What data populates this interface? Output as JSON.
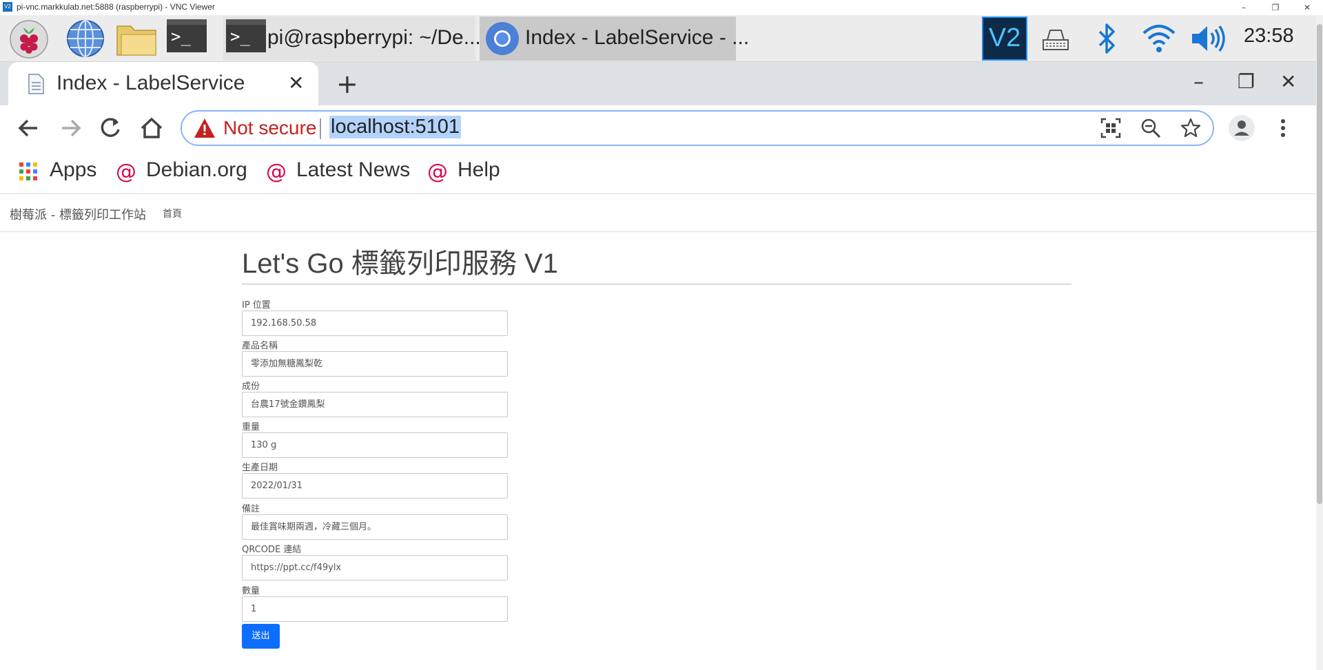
{
  "vnc_window": {
    "logo_text": "V2",
    "title": "pi-vnc.markkulab.net:5888 (raspberrypi) - VNC Viewer",
    "minimize": "–",
    "restore": "❐",
    "close": "✕"
  },
  "taskbar": {
    "terminal_prompt": ">_",
    "terminal_task_label": "pi@raspberrypi: ~/De...",
    "browser_task_label": "Index - LabelService - ...",
    "vnc_tray_text": "V2",
    "time": "23:58"
  },
  "browser": {
    "tab_title": "Index - LabelService",
    "tab_close": "✕",
    "new_tab": "+",
    "window_minimize": "–",
    "window_restore": "❐",
    "window_close": "✕",
    "security_label": "Not secure",
    "url": "localhost:5101",
    "bookmarks": [
      {
        "label": "Apps"
      },
      {
        "label": "Debian.org"
      },
      {
        "label": "Latest News"
      },
      {
        "label": "Help"
      }
    ],
    "debian_swirl": "@"
  },
  "page": {
    "brand": "樹莓派 - 標籤列印工作站",
    "nav_home": "首頁",
    "heading": "Let's Go 標籤列印服務 V1",
    "fields": [
      {
        "label": "IP 位置",
        "value": "192.168.50.58"
      },
      {
        "label": "產品名稱",
        "value": "零添加無糖鳳梨乾"
      },
      {
        "label": "成份",
        "value": "台農17號金鑽鳳梨"
      },
      {
        "label": "重量",
        "value": "130 g"
      },
      {
        "label": "生產日期",
        "value": "2022/01/31"
      },
      {
        "label": "備註",
        "value": "最佳賞味期兩週，冷藏三個月。"
      },
      {
        "label": "QRCODE 連結",
        "value": "https://ppt.cc/f49ylx"
      },
      {
        "label": "數量",
        "value": "1"
      }
    ],
    "submit_label": "送出"
  }
}
